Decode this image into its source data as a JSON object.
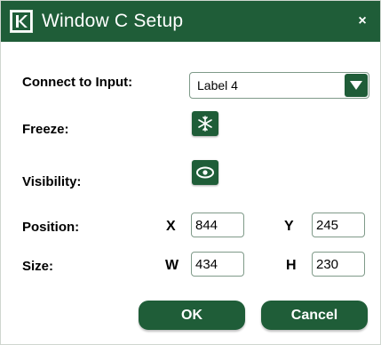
{
  "dialog": {
    "title": "Window C Setup",
    "close_glyph": "×",
    "logo_icon": "kramer-k-logo",
    "accent_color": "#1f5d38"
  },
  "connect": {
    "label": "Connect to Input:",
    "selected": "Label 4",
    "dropdown_icon": "triangle-down-icon"
  },
  "freeze": {
    "label": "Freeze:",
    "icon": "snowflake-icon"
  },
  "visibility": {
    "label": "Visibility:",
    "icon": "eye-icon"
  },
  "position": {
    "label": "Position:",
    "x_label": "X",
    "x_value": "844",
    "y_label": "Y",
    "y_value": "245"
  },
  "size": {
    "label": "Size:",
    "w_label": "W",
    "w_value": "434",
    "h_label": "H",
    "h_value": "230"
  },
  "buttons": {
    "ok": "OK",
    "cancel": "Cancel"
  }
}
